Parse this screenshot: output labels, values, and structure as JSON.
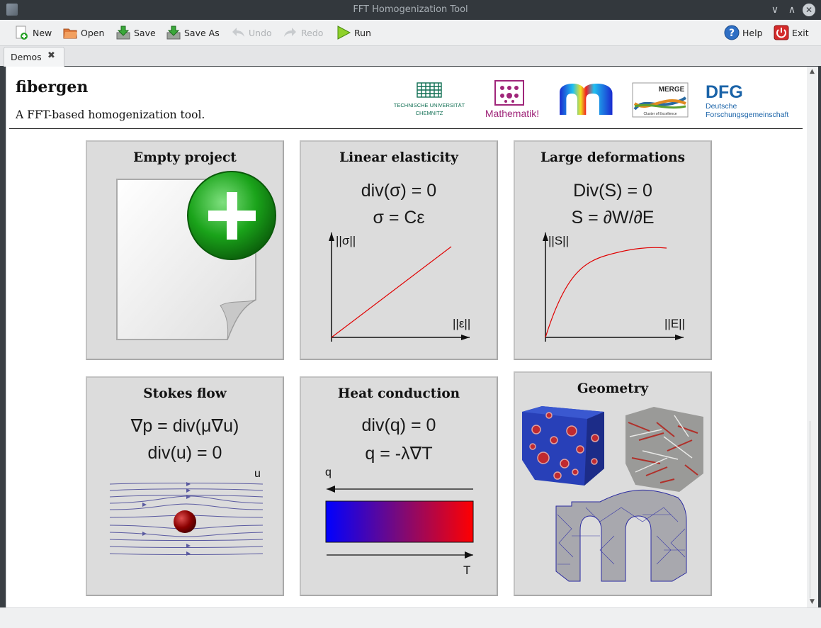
{
  "window": {
    "title": "FFT Homogenization Tool"
  },
  "toolbar": {
    "new": "New",
    "open": "Open",
    "save": "Save",
    "save_as": "Save As",
    "undo": "Undo",
    "redo": "Redo",
    "run": "Run",
    "help": "Help",
    "exit": "Exit"
  },
  "tabs": [
    {
      "label": "Demos"
    }
  ],
  "page": {
    "heading": "fibergen",
    "subtitle": "A FFT-based homogenization tool.",
    "logos": {
      "tuc_line1": "TECHNISCHE UNIVERSITÄT",
      "tuc_line2": "CHEMNITZ",
      "mathematik": "Mathematik!",
      "merge": "MERGE",
      "merge_sub": "Cluster of Excellence",
      "dfg": "DFG",
      "dfg_line1": "Deutsche",
      "dfg_line2": "Forschungsgemeinschaft"
    }
  },
  "cards": {
    "empty": {
      "title": "Empty project"
    },
    "linear": {
      "title": "Linear elasticity",
      "eq1": "div(σ) = 0",
      "eq2": "σ = Cε",
      "ylabel": "||σ||",
      "xlabel": "||ε||"
    },
    "large": {
      "title": "Large deformations",
      "eq1": "Div(S) = 0",
      "eq2": "S = ∂W/∂E",
      "ylabel": "||S||",
      "xlabel": "||E||"
    },
    "stokes": {
      "title": "Stokes flow",
      "eq1": "∇p = div(μ∇u)",
      "eq2": "div(u) = 0",
      "ulabel": "u"
    },
    "heat": {
      "title": "Heat conduction",
      "eq1": "div(q) = 0",
      "eq2": "q = -λ∇T",
      "qlabel": "q",
      "tlabel": "T"
    },
    "geometry": {
      "title": "Geometry"
    }
  },
  "colors": {
    "titlebar": "#33383d",
    "toolbar": "#eff0f1",
    "card": "#dcdcdc",
    "plus_green": "#1aa31a",
    "curve_red": "#e00000"
  }
}
